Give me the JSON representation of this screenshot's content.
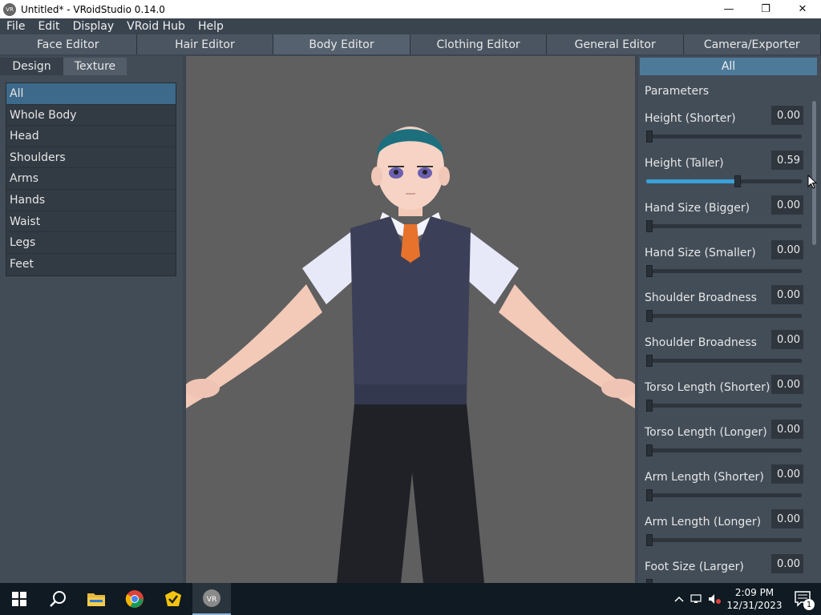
{
  "window": {
    "title": "Untitled* - VRoidStudio 0.14.0",
    "app_icon_text": "VR",
    "controls": {
      "minimize": "—",
      "restore": "❐",
      "close": "✕"
    }
  },
  "menu": [
    "File",
    "Edit",
    "Display",
    "VRoid Hub",
    "Help"
  ],
  "editor_tabs": [
    "Face Editor",
    "Hair Editor",
    "Body Editor",
    "Clothing Editor",
    "General Editor",
    "Camera/Exporter"
  ],
  "active_editor_tab": "Body Editor",
  "left_panel": {
    "tabs": [
      "Design",
      "Texture"
    ],
    "categories": [
      "All",
      "Whole Body",
      "Head",
      "Shoulders",
      "Arms",
      "Hands",
      "Waist",
      "Legs",
      "Feet"
    ],
    "selected_category": "All"
  },
  "right_panel": {
    "header": "All",
    "section_label": "Parameters",
    "parameters": [
      {
        "label": "Height (Shorter)",
        "value": "0.00",
        "level": 0.0
      },
      {
        "label": "Height (Taller)",
        "value": "0.59",
        "level": 0.59
      },
      {
        "label": "Hand Size (Bigger)",
        "value": "0.00",
        "level": 0.0
      },
      {
        "label": "Hand Size (Smaller)",
        "value": "0.00",
        "level": 0.0
      },
      {
        "label": "Shoulder Broadness",
        "value": "0.00",
        "level": 0.0
      },
      {
        "label": "Shoulder Broadness",
        "value": "0.00",
        "level": 0.0
      },
      {
        "label": "Torso Length (Shorter)",
        "value": "0.00",
        "level": 0.0
      },
      {
        "label": "Torso Length (Longer)",
        "value": "0.00",
        "level": 0.0
      },
      {
        "label": "Arm Length (Shorter)",
        "value": "0.00",
        "level": 0.0
      },
      {
        "label": "Arm Length (Longer)",
        "value": "0.00",
        "level": 0.0
      },
      {
        "label": "Foot Size (Larger)",
        "value": "0.00",
        "level": 0.0
      }
    ]
  },
  "taskbar": {
    "items": [
      "windows-start",
      "search",
      "file-explorer",
      "chrome",
      "norton",
      "vroid-studio"
    ],
    "time": "2:09 PM",
    "date": "12/31/2023",
    "notification_count": "1"
  },
  "colors": {
    "accent": "#3aa0d8",
    "selected_category": "#3d6a8a",
    "panel": "#424c57",
    "viewport_bg": "#5f5f5f"
  }
}
